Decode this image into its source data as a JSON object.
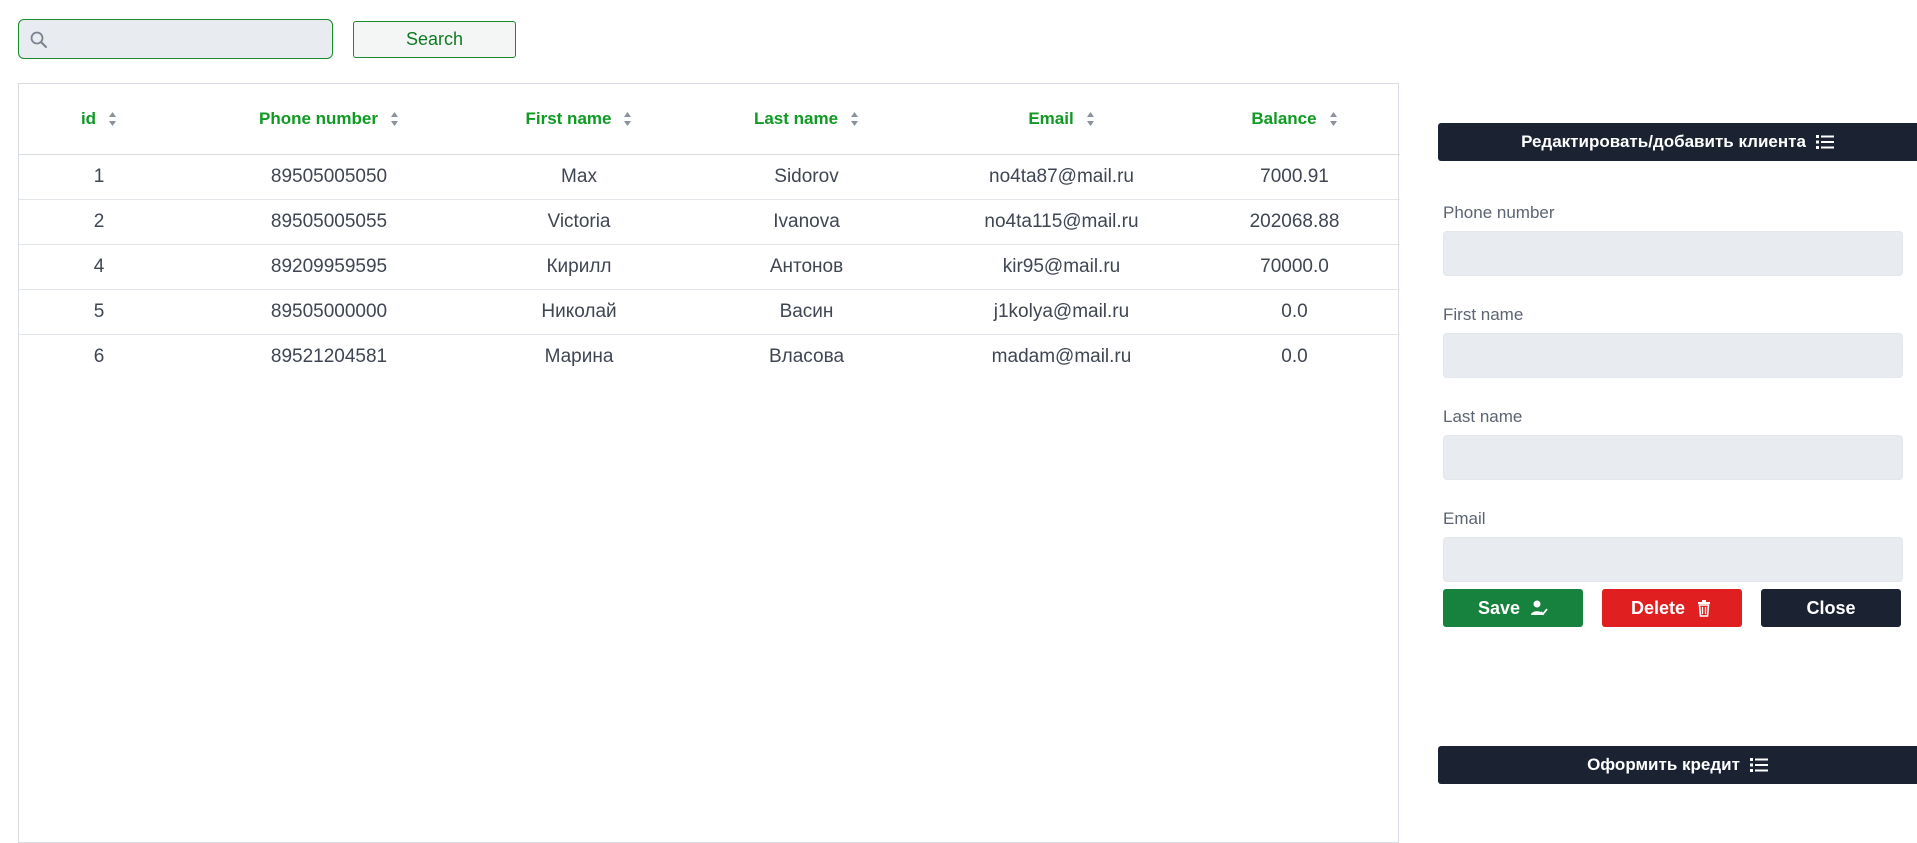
{
  "search": {
    "placeholder": "",
    "value": "",
    "button_label": "Search"
  },
  "table": {
    "columns": [
      "id",
      "Phone number",
      "First name",
      "Last name",
      "Email",
      "Balance"
    ],
    "rows": [
      [
        "1",
        "89505005050",
        "Max",
        "Sidorov",
        "no4ta87@mail.ru",
        "7000.91"
      ],
      [
        "2",
        "89505005055",
        "Victoria",
        "Ivanova",
        "no4ta115@mail.ru",
        "202068.88"
      ],
      [
        "4",
        "89209959595",
        "Кирилл",
        "Антонов",
        "kir95@mail.ru",
        "70000.0"
      ],
      [
        "5",
        "89505000000",
        "Николай",
        "Васин",
        "j1kolya@mail.ru",
        "0.0"
      ],
      [
        "6",
        "89521204581",
        "Марина",
        "Власова",
        "madam@mail.ru",
        "0.0"
      ]
    ]
  },
  "side": {
    "edit_header": "Редактировать/добавить клиента",
    "fields": {
      "phone_label": "Phone number",
      "first_label": "First name",
      "last_label": "Last name",
      "email_label": "Email"
    },
    "buttons": {
      "save": "Save",
      "delete": "Delete",
      "close": "Close"
    },
    "credit_header": "Оформить кредит"
  },
  "colors": {
    "accent_green": "#0f9a23",
    "dark_navy": "#1b2333",
    "danger_red": "#e02020",
    "save_green": "#16823d"
  },
  "icons": [
    "search-icon",
    "sort-icon",
    "list-icon",
    "user-check-icon",
    "trash-icon"
  ]
}
